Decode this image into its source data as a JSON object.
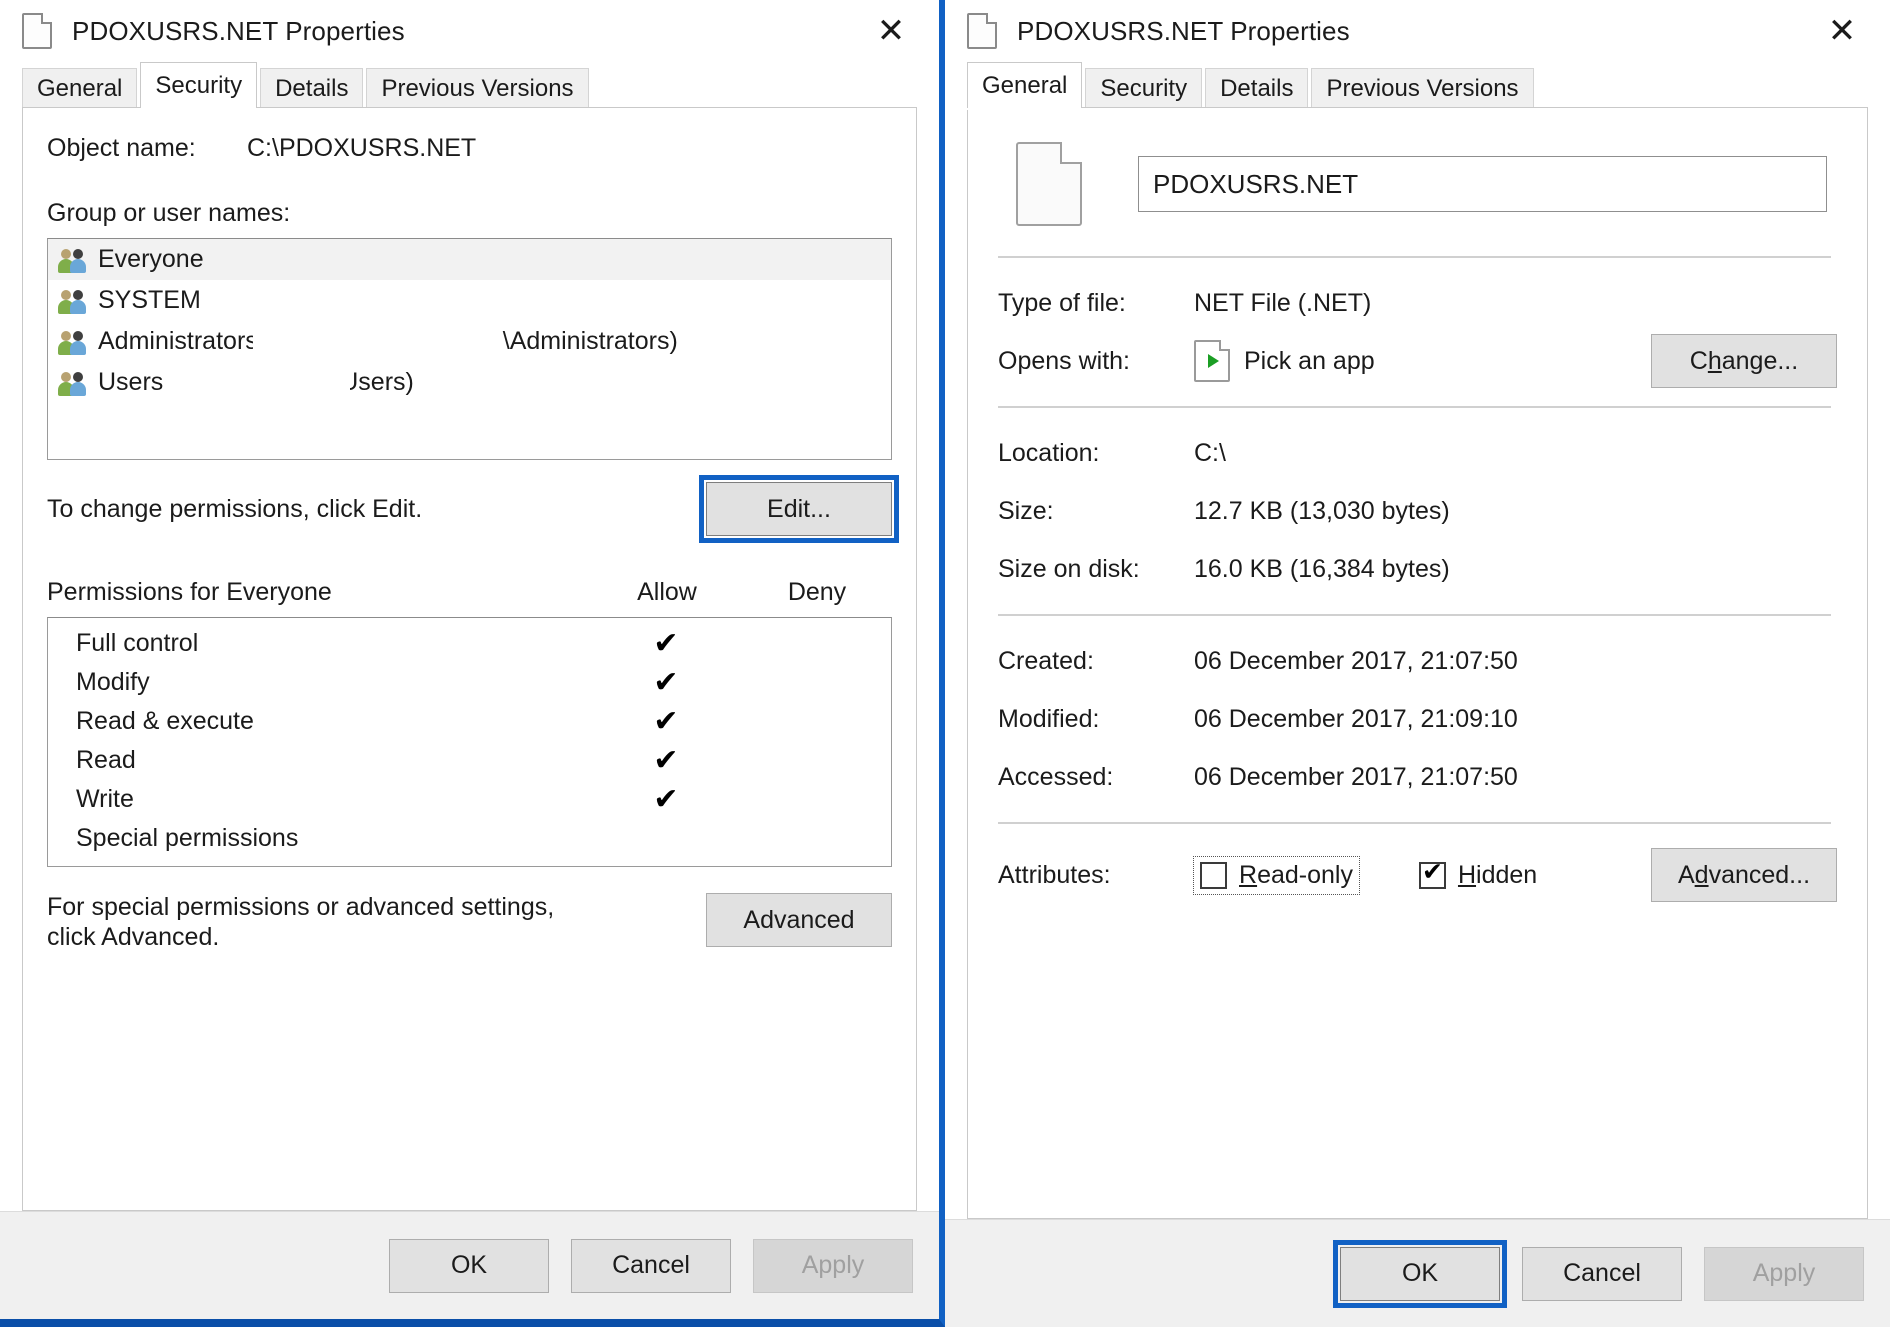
{
  "left_dialog": {
    "title": "PDOXUSRS.NET Properties",
    "title_icon": "file-icon",
    "close_label": "✕",
    "tabs": [
      {
        "label": "General",
        "active": false
      },
      {
        "label": "Security",
        "active": true
      },
      {
        "label": "Details",
        "active": false
      },
      {
        "label": "Previous Versions",
        "active": false
      }
    ],
    "object_name_label": "Object name:",
    "object_name_value": "C:\\PDOXUSRS.NET",
    "group_label": "Group or user names:",
    "group_items": [
      {
        "name": "Everyone",
        "suffix": "",
        "selected": true
      },
      {
        "name": "SYSTEM",
        "suffix": "",
        "selected": false
      },
      {
        "name": "Administrators",
        "suffix": "\\Administrators)",
        "selected": false
      },
      {
        "name": "Users",
        "suffix": "\\Users)",
        "selected": false
      }
    ],
    "change_hint": "To change permissions, click Edit.",
    "edit_button": "Edit...",
    "permissions_header": "Permissions for Everyone",
    "allow_header": "Allow",
    "deny_header": "Deny",
    "permissions": [
      {
        "name": "Full control",
        "allow": "✔",
        "deny": ""
      },
      {
        "name": "Modify",
        "allow": "✔",
        "deny": ""
      },
      {
        "name": "Read & execute",
        "allow": "✔",
        "deny": ""
      },
      {
        "name": "Read",
        "allow": "✔",
        "deny": ""
      },
      {
        "name": "Write",
        "allow": "✔",
        "deny": ""
      },
      {
        "name": "Special permissions",
        "allow": "",
        "deny": ""
      }
    ],
    "advanced_hint_line1": "For special permissions or advanced settings,",
    "advanced_hint_line2": "click Advanced.",
    "advanced_button": "Advanced",
    "ok_button": "OK",
    "cancel_button": "Cancel",
    "apply_button": "Apply"
  },
  "right_dialog": {
    "title": "PDOXUSRS.NET Properties",
    "title_icon": "file-icon",
    "close_label": "✕",
    "tabs": [
      {
        "label": "General",
        "active": true
      },
      {
        "label": "Security",
        "active": false
      },
      {
        "label": "Details",
        "active": false
      },
      {
        "label": "Previous Versions",
        "active": false
      }
    ],
    "file_name_value": "PDOXUSRS.NET",
    "rows": [
      {
        "label": "Type of file:",
        "value": "NET File (.NET)"
      },
      {
        "label": "Location:",
        "value": "C:\\"
      },
      {
        "label": "Size:",
        "value": "12.7 KB (13,030 bytes)"
      },
      {
        "label": "Size on disk:",
        "value": "16.0 KB (16,384 bytes)"
      },
      {
        "label": "Created:",
        "value": "06 December 2017, 21:07:50"
      },
      {
        "label": "Modified:",
        "value": "06 December 2017, 21:09:10"
      },
      {
        "label": "Accessed:",
        "value": "06 December 2017, 21:07:50"
      }
    ],
    "opens_with_label": "Opens with:",
    "opens_with_value": "Pick an app",
    "change_button": {
      "pre": "C",
      "accel": "h",
      "post": "ange..."
    },
    "attributes_label": "Attributes:",
    "readonly_checkbox": {
      "pre": "R",
      "accel": "",
      "post": "ead-only",
      "checked": false
    },
    "hidden_checkbox": {
      "pre": "",
      "accel": "H",
      "post": "idden",
      "checked": true
    },
    "advanced_button": {
      "pre": "A",
      "accel": "d",
      "post": "vanced..."
    },
    "ok_button": "OK",
    "cancel_button": "Cancel",
    "apply_button": "Apply"
  }
}
